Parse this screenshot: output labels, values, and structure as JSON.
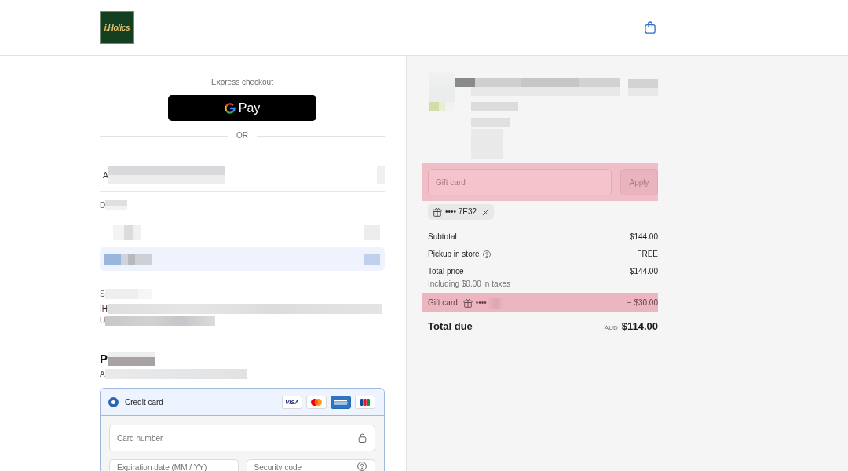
{
  "header": {
    "logo_text": "i.Holics"
  },
  "express_checkout": {
    "label": "Express checkout",
    "button": "Pay",
    "divider": "OR"
  },
  "section_1": {
    "text": "A"
  },
  "section_2": {
    "heading": "D",
    "options": [
      {
        "selected": false
      },
      {
        "selected": true
      }
    ]
  },
  "section_3": {
    "heading": "S",
    "lines": [
      "IH",
      "U"
    ]
  },
  "payment": {
    "heading": "P",
    "subtitle": "A",
    "methods": [
      {
        "label": "Credit card",
        "selected": true,
        "brands": [
          {
            "kind": "visa",
            "text": "VISA"
          },
          {
            "kind": "mastercard"
          },
          {
            "kind": "amex"
          },
          {
            "kind": "jcb"
          }
        ],
        "fields": [
          {
            "kind": "card_number",
            "placeholder": "Card number"
          },
          {
            "kind": "expiry",
            "placeholder": "Expiration date (MM / YY)"
          },
          {
            "kind": "security_code",
            "placeholder": "Security code"
          }
        ]
      }
    ]
  },
  "order_summary": {
    "gift_card_form": {
      "placeholder": "Gift card",
      "button": "Apply",
      "button_disabled": true,
      "highlighted": true
    },
    "applied_gift_cards": [
      {
        "code": "•••• 7E32"
      }
    ],
    "lines": [
      {
        "kind": "subtotal",
        "label": "Subtotal",
        "value": "$144.00",
        "highlighted": false
      },
      {
        "kind": "shipping",
        "label": "Pickup in store",
        "value": "FREE",
        "highlighted": false
      },
      {
        "kind": "total",
        "label": "Total price",
        "value": "$144.00",
        "note": "Including $0.00 in taxes",
        "highlighted": false
      },
      {
        "kind": "gift_card",
        "label": "Gift card",
        "code": "••••",
        "value": "− $30.00",
        "highlighted": true
      }
    ],
    "total": {
      "label": "Total due",
      "currency": "AUD",
      "value": "$114.00"
    }
  }
}
